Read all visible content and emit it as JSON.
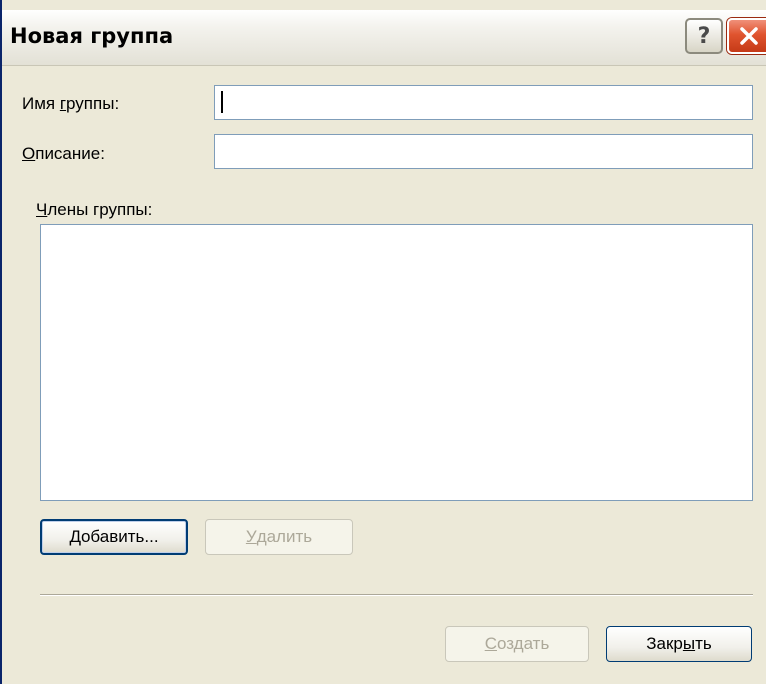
{
  "window": {
    "title": "Новая группа",
    "help_glyph": "?"
  },
  "form": {
    "group_name_label_pre": "Имя ",
    "group_name_label_accel": "г",
    "group_name_label_post": "руппы:",
    "group_name_value": "",
    "description_label_accel": "О",
    "description_label_post": "писание:",
    "description_value": "",
    "members_label_accel": "Ч",
    "members_label_post": "лены группы:"
  },
  "buttons": {
    "add_accel": "Д",
    "add_post": "обавить...",
    "remove_accel": "У",
    "remove_post": "далить",
    "create_accel": "С",
    "create_post": "оздать",
    "close_pre": "Закр",
    "close_accel": "ы",
    "close_post": "ть"
  },
  "icons": {
    "help": "help-icon",
    "close": "close-icon"
  },
  "colors": {
    "dialog_bg": "#ECE9D8",
    "close_red": "#E0542F",
    "field_border": "#7F9DB9",
    "disabled_text": "#ACA899"
  }
}
